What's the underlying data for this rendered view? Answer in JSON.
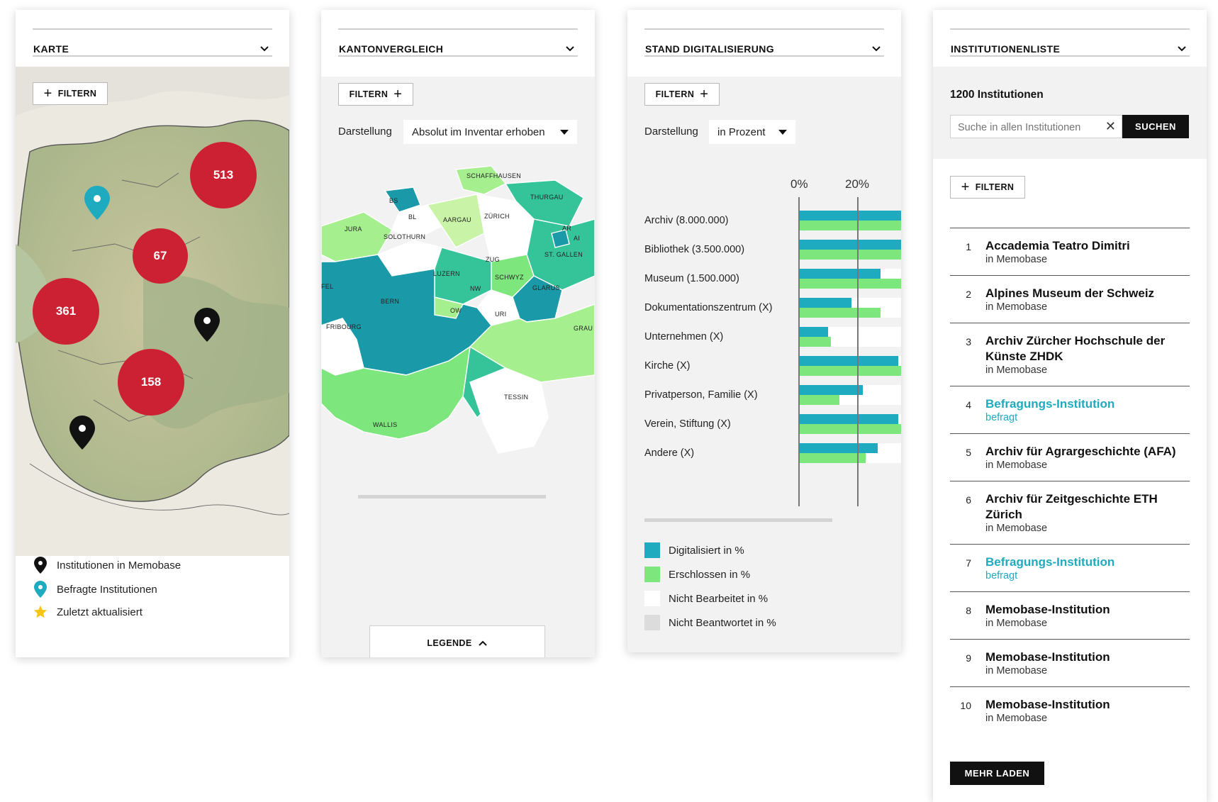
{
  "colors": {
    "accent_red": "#cc2033",
    "teal": "#1eabbf",
    "green": "#7de67d",
    "black": "#111111"
  },
  "map_panel": {
    "title": "KARTE",
    "filter_label": "FILTERN",
    "clusters": [
      "513",
      "67",
      "361",
      "158"
    ],
    "legend": [
      {
        "icon": "black-pin-icon",
        "label": "Institutionen in Memobase"
      },
      {
        "icon": "teal-pin-icon",
        "label": "Befragte Institutionen"
      },
      {
        "icon": "star-icon",
        "label": "Zuletzt aktualisiert"
      }
    ]
  },
  "canton_panel": {
    "title": "KANTONVERGLEICH",
    "filter_label": "FILTERN",
    "display_label": "Darstellung",
    "display_value": "Absolut im Inventar erhoben",
    "cantons": [
      "SCHAFFHAUSEN",
      "THURGAU",
      "BS",
      "BL",
      "AARGAU",
      "ZÜRICH",
      "JURA",
      "SOLOTHURN",
      "AR",
      "AI",
      "ST. GALLEN",
      "ZUG",
      "LUZERN",
      "SCHWYZ",
      "GLARUS",
      "BERN",
      "NW",
      "OW",
      "URI",
      "FRIBOURG",
      "GRAU",
      "TESSIN",
      "WALLIS",
      "FEL"
    ],
    "legend_button": "LEGENDE"
  },
  "digital_panel": {
    "title": "STAND DIGITALISIERUNG",
    "filter_label": "FILTERN",
    "display_label": "Darstellung",
    "display_value": "in Prozent",
    "legend": [
      {
        "color": "#1eabbf",
        "label": "Digitalisiert in %"
      },
      {
        "color": "#7de67d",
        "label": "Erschlossen in %"
      },
      {
        "color": "#ffffff",
        "label": "Nicht Bearbeitet in %"
      },
      {
        "color": "#dcdcdc",
        "label": "Nicht Beantwortet in %"
      }
    ]
  },
  "chart_data": {
    "type": "bar",
    "orientation": "horizontal",
    "categories": [
      "Archiv (8.000.000)",
      "Bibliothek (3.500.000)",
      "Museum (1.500.000)",
      "Dokumentationszentrum (X)",
      "Unternehmen (X)",
      "Kirche (X)",
      "Privatperson, Familie (X)",
      "Verein, Stiftung (X)",
      "Andere (X)"
    ],
    "x_tick_labels": [
      "0%",
      "20%"
    ],
    "visible_range": [
      0,
      35
    ],
    "series": [
      {
        "name": "Digitalisiert in %",
        "color": "#1eabbf",
        "values": [
          36,
          36,
          28,
          18,
          10,
          34,
          22,
          34,
          27
        ]
      },
      {
        "name": "Erschlossen in %",
        "color": "#7de67d",
        "values": [
          36,
          36,
          36,
          28,
          11,
          36,
          14,
          36,
          23
        ]
      }
    ]
  },
  "list_panel": {
    "title": "INSTITUTIONENLISTE",
    "count_text": "1200 Institutionen",
    "search_placeholder": "Suche in allen Institutionen",
    "search_button": "SUCHEN",
    "filter_label": "FILTERN",
    "items": [
      {
        "num": "1",
        "name": "Accademia Teatro Dimitri",
        "sub": "in Memobase"
      },
      {
        "num": "2",
        "name": "Alpines Museum der Schweiz",
        "sub": "in Memobase"
      },
      {
        "num": "3",
        "name": "Archiv Zürcher Hochschule der Künste ZHDK",
        "sub": "in Memobase"
      },
      {
        "num": "4",
        "name": "Befragungs-Institution",
        "sub": "befragt"
      },
      {
        "num": "5",
        "name": "Archiv für Agrargeschichte (AFA)",
        "sub": "in Memobase"
      },
      {
        "num": "6",
        "name": "Archiv für Zeitgeschichte ETH Zürich",
        "sub": "in Memobase"
      },
      {
        "num": "7",
        "name": "Befragungs-Institution",
        "sub": "befragt"
      },
      {
        "num": "8",
        "name": "Memobase-Institution",
        "sub": "in Memobase"
      },
      {
        "num": "9",
        "name": "Memobase-Institution",
        "sub": "in Memobase"
      },
      {
        "num": "10",
        "name": "Memobase-Institution",
        "sub": "in Memobase"
      }
    ],
    "load_more": "MEHR LADEN"
  }
}
